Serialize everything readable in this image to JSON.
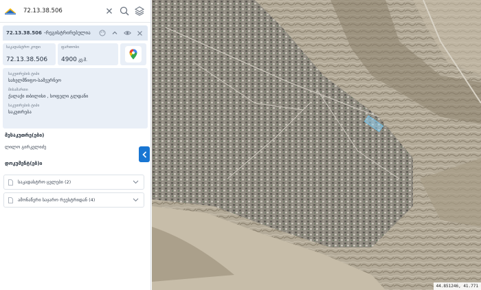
{
  "search": {
    "value": "72.13.38.506"
  },
  "card": {
    "code": "72.13.38.506",
    "subtitle": "-რეგისტრირებულია",
    "cadastral_label": "საკადასტრო კოდი",
    "cadastral_code": "72.13.38.506",
    "area_label": "ფართობი",
    "area_value": "4900",
    "area_unit": "კვ.მ."
  },
  "info": [
    {
      "label": "საკუთრების ტიპი",
      "value": "სახელმწიფო-სამეურნეო"
    },
    {
      "label": "მისამართი",
      "value": "ქალაქი თბილისი , სოფელი გლდანი"
    },
    {
      "label": "საკუთრების ტიპი",
      "value": "საკუთრება"
    }
  ],
  "owners": {
    "title": "მესაკუთრე(ები)",
    "address": "ლილო გირკელიძე"
  },
  "documents": {
    "title": "დოკუმენტ(ებ)ი",
    "items": [
      "საკადასტრო ცვლები (2)",
      "ამონაწერი საჯარო რეესტრიდან (4)"
    ]
  },
  "map": {
    "coords": "44.851246, 41.771"
  }
}
